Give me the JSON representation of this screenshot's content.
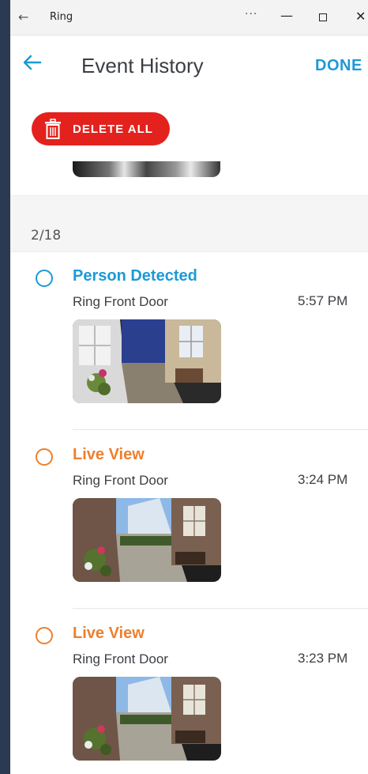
{
  "titlebar": {
    "app_name": "Ring",
    "more_label": "···",
    "minimize_label": "—",
    "close_label": "✕"
  },
  "header": {
    "back_icon": "arrow-left-icon",
    "title": "Event History",
    "done_label": "DONE"
  },
  "toolbar": {
    "delete_all_label": "DELETE ALL"
  },
  "date_group": "2/18",
  "events": [
    {
      "title": "Person Detected",
      "device": "Ring Front Door",
      "time": "5:57 PM",
      "color": "#1c9ad6",
      "thumbnail": "doorbell-camera-snapshot"
    },
    {
      "title": "Live View",
      "device": "Ring Front Door",
      "time": "3:24 PM",
      "color": "#ee7f2d",
      "thumbnail": "doorbell-camera-snapshot"
    },
    {
      "title": "Live View",
      "device": "Ring Front Door",
      "time": "3:23 PM",
      "color": "#ee7f2d",
      "thumbnail": "doorbell-camera-snapshot"
    }
  ],
  "colors": {
    "accent": "#1c9ad6",
    "delete": "#e3221e",
    "live_view": "#ee7f2d"
  }
}
